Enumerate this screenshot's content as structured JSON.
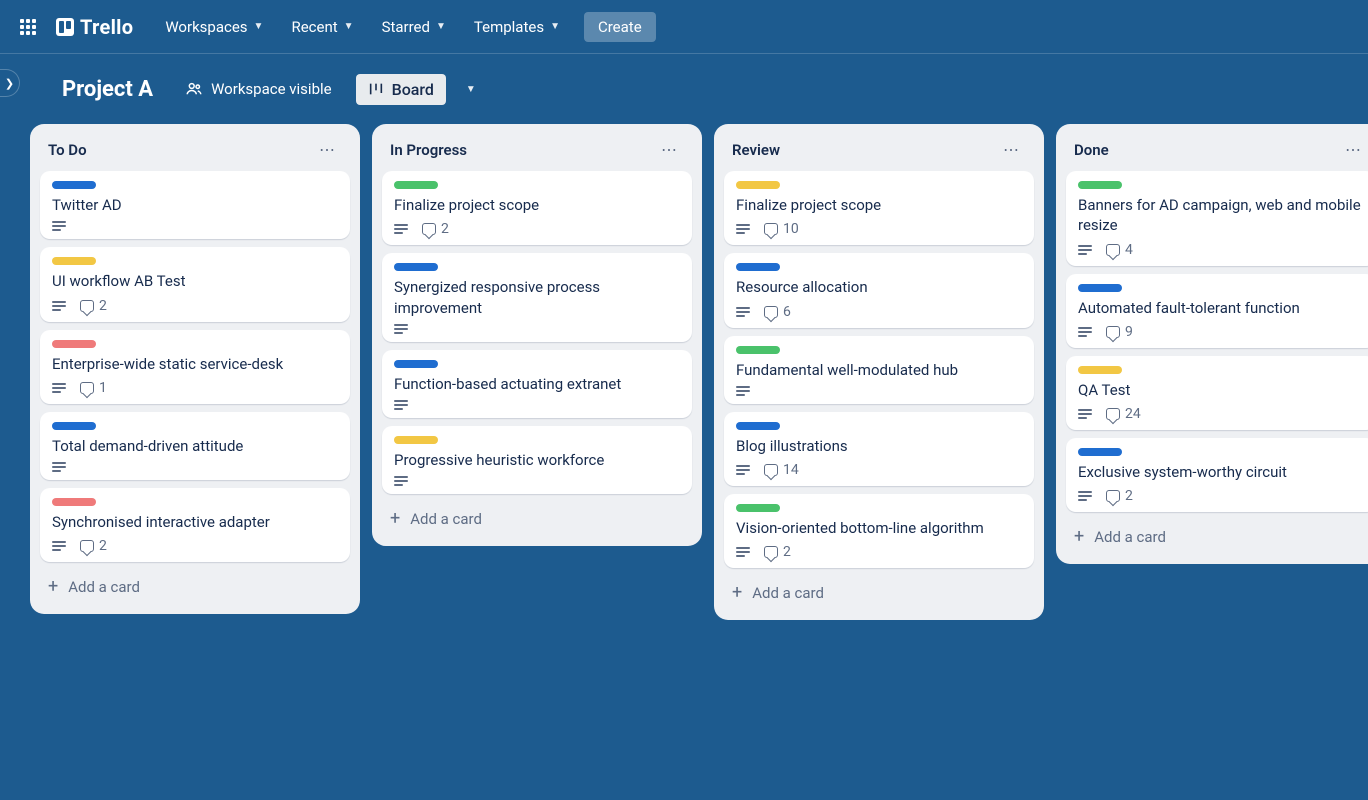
{
  "nav": {
    "logo": "Trello",
    "items": [
      "Workspaces",
      "Recent",
      "Starred",
      "Templates"
    ],
    "create": "Create"
  },
  "board": {
    "title": "Project A",
    "visibility": "Workspace visible",
    "view": "Board"
  },
  "addCardLabel": "Add a card",
  "labelColors": {
    "blue": "lbl-blue",
    "yellow": "lbl-yellow",
    "red": "lbl-red",
    "green": "lbl-green"
  },
  "lists": [
    {
      "title": "To Do",
      "cards": [
        {
          "label": "blue",
          "title": "Twitter AD",
          "hasDesc": true,
          "comments": null
        },
        {
          "label": "yellow",
          "title": "UI workflow AB Test",
          "hasDesc": true,
          "comments": 2
        },
        {
          "label": "red",
          "title": "Enterprise-wide static service-desk",
          "hasDesc": true,
          "comments": 1
        },
        {
          "label": "blue",
          "title": "Total demand-driven attitude",
          "hasDesc": true,
          "comments": null
        },
        {
          "label": "red",
          "title": "Synchronised interactive adapter",
          "hasDesc": true,
          "comments": 2
        }
      ]
    },
    {
      "title": "In Progress",
      "cards": [
        {
          "label": "green",
          "title": "Finalize project scope",
          "hasDesc": true,
          "comments": 2
        },
        {
          "label": "blue",
          "title": "Synergized responsive process improvement",
          "hasDesc": true,
          "comments": null
        },
        {
          "label": "blue",
          "title": "Function-based actuating extranet",
          "hasDesc": true,
          "comments": null
        },
        {
          "label": "yellow",
          "title": "Progressive heuristic workforce",
          "hasDesc": true,
          "comments": null
        }
      ]
    },
    {
      "title": "Review",
      "cards": [
        {
          "label": "yellow",
          "title": "Finalize project scope",
          "hasDesc": true,
          "comments": 10
        },
        {
          "label": "blue",
          "title": "Resource allocation",
          "hasDesc": true,
          "comments": 6
        },
        {
          "label": "green",
          "title": "Fundamental well-modulated hub",
          "hasDesc": true,
          "comments": null
        },
        {
          "label": "blue",
          "title": "Blog illustrations",
          "hasDesc": true,
          "comments": 14
        },
        {
          "label": "green",
          "title": "Vision-oriented bottom-line algorithm",
          "hasDesc": true,
          "comments": 2
        }
      ]
    },
    {
      "title": "Done",
      "cards": [
        {
          "label": "green",
          "title": "Banners for AD campaign, web and mobile resize",
          "hasDesc": true,
          "comments": 4
        },
        {
          "label": "blue",
          "title": "Automated fault-tolerant function",
          "hasDesc": true,
          "comments": 9
        },
        {
          "label": "yellow",
          "title": "QA Test",
          "hasDesc": true,
          "comments": 24
        },
        {
          "label": "blue",
          "title": "Exclusive system-worthy circuit",
          "hasDesc": true,
          "comments": 2
        }
      ]
    }
  ]
}
